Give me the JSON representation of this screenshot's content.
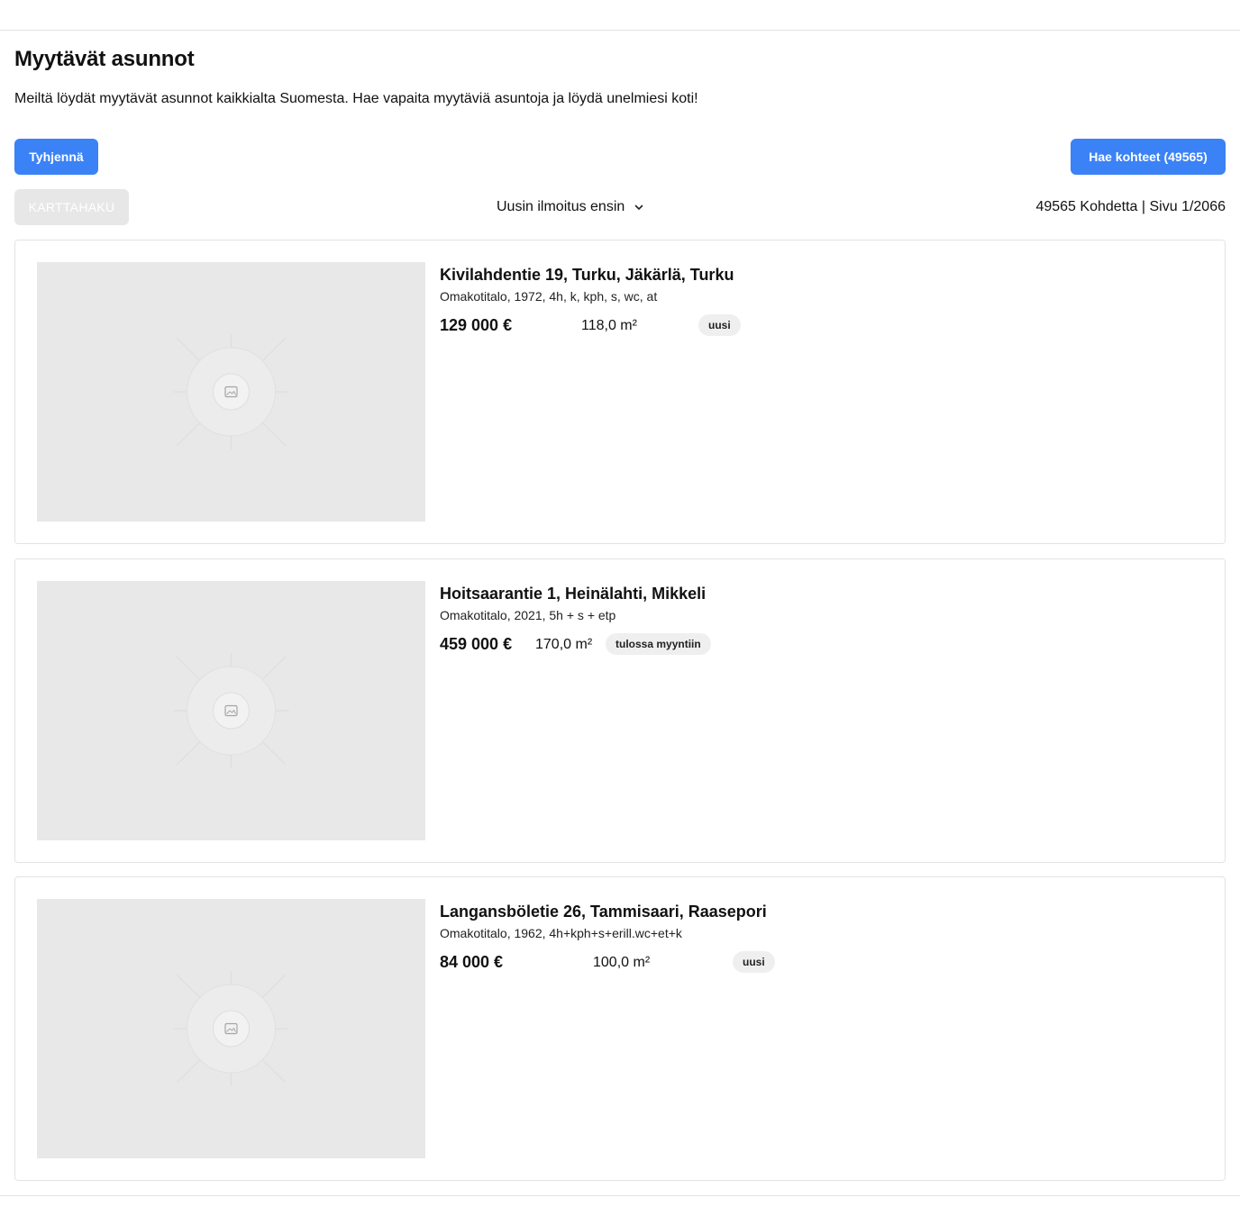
{
  "header": {
    "title": "Myytävät asunnot",
    "description": "Meiltä löydät myytävät asunnot kaikkialta Suomesta. Hae vapaita myytäviä asuntoja ja löydä unelmiesi koti!"
  },
  "toolbar": {
    "clear_label": "Tyhjennä",
    "search_label": "Hae kohteet (49565)",
    "map_label": "KARTTAHAKU",
    "sort_label": "Uusin ilmoitus ensin",
    "sort_icon": "chevron-down-icon",
    "results_summary": "49565 Kohdetta | Sivu 1/2066"
  },
  "listings": [
    {
      "title": "Kivilahdentie 19, Turku, Jäkärlä, Turku",
      "subtitle": "Omakotitalo, 1972, 4h, k, kph, s, wc, at",
      "price": "129 000 €",
      "area": "118,0 m²",
      "badge": "uusi",
      "image_icon": "image-placeholder-icon"
    },
    {
      "title": "Hoitsaarantie 1, Heinälahti, Mikkeli",
      "subtitle": "Omakotitalo, 2021, 5h + s + etp",
      "price": "459 000 €",
      "area": "170,0 m²",
      "badge": "tulossa myyntiin",
      "image_icon": "image-placeholder-icon"
    },
    {
      "title": "Langansböletie 26, Tammisaari, Raasepori",
      "subtitle": "Omakotitalo, 1962, 4h+kph+s+erill.wc+et+k",
      "price": "84 000 €",
      "area": "100,0 m²",
      "badge": "uusi",
      "image_icon": "image-placeholder-icon"
    }
  ],
  "colors": {
    "primary": "#3b82f6",
    "disabled_button": "#e7e7e7",
    "placeholder_bg": "#e8e8e8",
    "badge_bg": "#efefef",
    "border": "#e3e3e3"
  }
}
